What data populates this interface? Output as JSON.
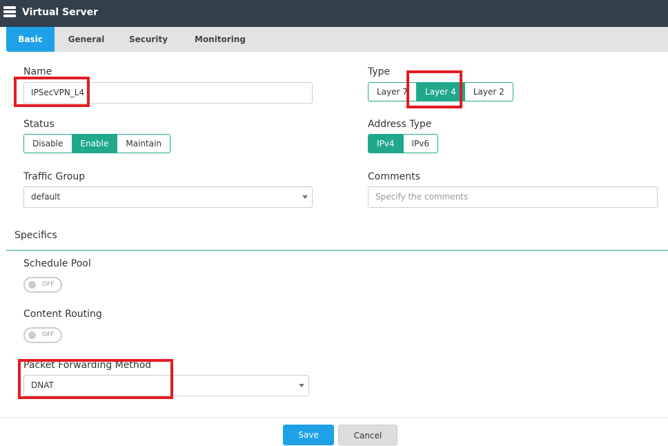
{
  "header": {
    "title": "Virtual Server",
    "icon": "server-icon"
  },
  "tabs": [
    "Basic",
    "General",
    "Security",
    "Monitoring"
  ],
  "form": {
    "name": {
      "label": "Name",
      "value": "IPSecVPN_L4"
    },
    "type": {
      "label": "Type",
      "options": [
        "Layer 7",
        "Layer 4",
        "Layer 2"
      ],
      "selected": "Layer 4"
    },
    "status": {
      "label": "Status",
      "options": [
        "Disable",
        "Enable",
        "Maintain"
      ],
      "selected": "Enable"
    },
    "address_type": {
      "label": "Address Type",
      "options": [
        "IPv4",
        "IPv6"
      ],
      "selected": "IPv4"
    },
    "traffic_group": {
      "label": "Traffic Group",
      "value": "default"
    },
    "comments": {
      "label": "Comments",
      "placeholder": "Specify the comments"
    },
    "specifics": "Specifics",
    "schedule_pool": {
      "label": "Schedule Pool",
      "state": "OFF"
    },
    "content_routing": {
      "label": "Content Routing",
      "state": "OFF"
    },
    "packet_forwarding": {
      "label": "Packet Forwarding Method",
      "value": "DNAT"
    }
  },
  "buttons": {
    "save": "Save",
    "cancel": "Cancel"
  },
  "colors": {
    "accent": "#20a88c",
    "tab_active": "#1ea1e6",
    "highlight": "#e21b23"
  }
}
